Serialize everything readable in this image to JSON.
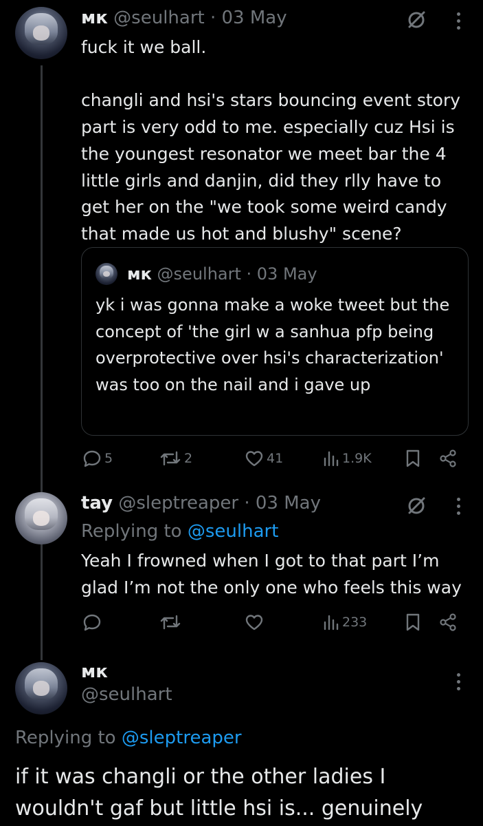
{
  "tweet1": {
    "display_name": "мк",
    "handle": "@seulhart",
    "sep": " · ",
    "date": "03 May",
    "body": "fuck it we ball.\n\nchangli and hsi's stars bouncing event story part is very odd to me. especially cuz Hsi is the youngest resonator we meet bar the 4 little girls and danjin, did they rlly have to get her on the \"we took some weird candy that made us hot and blushy\" scene?",
    "quote": {
      "display_name": "мк",
      "handle": "@seulhart",
      "sep": " · ",
      "date": "03 May",
      "body": "yk i was gonna make a woke tweet but the concept of 'the girl w a sanhua pfp being overprotective over hsi's characterization' was too on the nail and i gave up"
    },
    "actions": {
      "replies": "5",
      "reposts": "2",
      "likes": "41",
      "views": "1.9K"
    }
  },
  "tweet2": {
    "display_name": "tay",
    "handle": "@sleptreaper",
    "sep": " · ",
    "date": "03 May",
    "replying_prefix": "Replying to ",
    "replying_handle": "@seulhart",
    "body": "Yeah I frowned when I got to that part I’m glad I’m not the only one who feels this way",
    "actions": {
      "views": "233"
    }
  },
  "tweet3": {
    "display_name": "мк",
    "handle": "@seulhart",
    "replying_prefix": "Replying to ",
    "replying_handle": "@sleptreaper",
    "body": "if it was changli or the other ladies I wouldn't gaf but little hsi is... genuinely"
  },
  "icons": [
    "grok-icon",
    "more-icon",
    "reply-icon",
    "repost-icon",
    "like-icon",
    "views-icon",
    "bookmark-icon",
    "share-icon"
  ],
  "colors": {
    "background": "#000000",
    "text": "#e7e9ea",
    "muted": "#71767b",
    "link": "#1d9bf0",
    "divider": "#2f3336"
  }
}
